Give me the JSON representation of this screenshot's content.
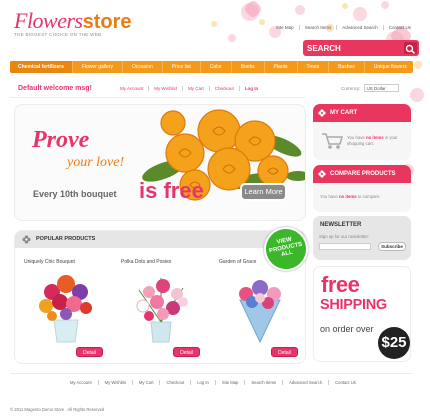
{
  "logo": {
    "word1": "Flowers",
    "word2": "store",
    "tagline": "THE BIGGEST CHOICE ON THE WEB"
  },
  "top_links": [
    "Site Map",
    "Search Items",
    "Advanced Search",
    "Contact Us"
  ],
  "search": {
    "label": "SEARCH"
  },
  "nav": [
    "Chemical fertilizers",
    "Flower gallery",
    "Occasion",
    "Price list",
    "Color",
    "Books",
    "Plants",
    "Trees",
    "Bushes",
    "Unique flowers"
  ],
  "welcome": "Default welcome msg!",
  "account_links": [
    "My Account",
    "My Wishlist",
    "My Cart",
    "Checkout",
    "Log In"
  ],
  "currency": {
    "label": "Currency:",
    "value": "US Dollar"
  },
  "banner": {
    "prove": "Prove",
    "love": "your love!",
    "every": "Every 10th bouquet",
    "is": "is",
    "free": "free",
    "button": "Learn More"
  },
  "popular": {
    "title": "POPULAR PRODUCTS",
    "view_all": [
      "VIEW",
      "PRODUCTS",
      "ALL"
    ],
    "products": [
      {
        "name": "Uniquely Chic Bouquet",
        "button": "Detail"
      },
      {
        "name": "Polka Dots and Posies",
        "button": "Detail"
      },
      {
        "name": "Garden of Grace",
        "button": "Detail"
      }
    ]
  },
  "cart": {
    "title": "MY CART",
    "text_pre": "You have",
    "text_em": "no items",
    "text_post": "in your shopping cart."
  },
  "compare": {
    "title": "COMPARE PRODUCTS",
    "text_pre": "You have",
    "text_em": "no items",
    "text_post": "to compare."
  },
  "newsletter": {
    "title": "NEWSLETTER",
    "label": "Sign up for our newsletter:",
    "button": "Subscribe"
  },
  "promo": {
    "free": "free",
    "shipping": "SHIPPING",
    "on_order": "on order over",
    "price": "$25"
  },
  "footer_links": [
    "My Account",
    "My Wishlist",
    "My Cart",
    "Checkout",
    "Log In",
    "Site Map",
    "Search Items",
    "Advanced Search",
    "Contact Us"
  ],
  "copyright": "© 2011 Magento Demo Store . All Rights Reserved",
  "colors": {
    "pink": "#e8346a",
    "orange": "#f49a1a",
    "green": "#3bb82a"
  }
}
